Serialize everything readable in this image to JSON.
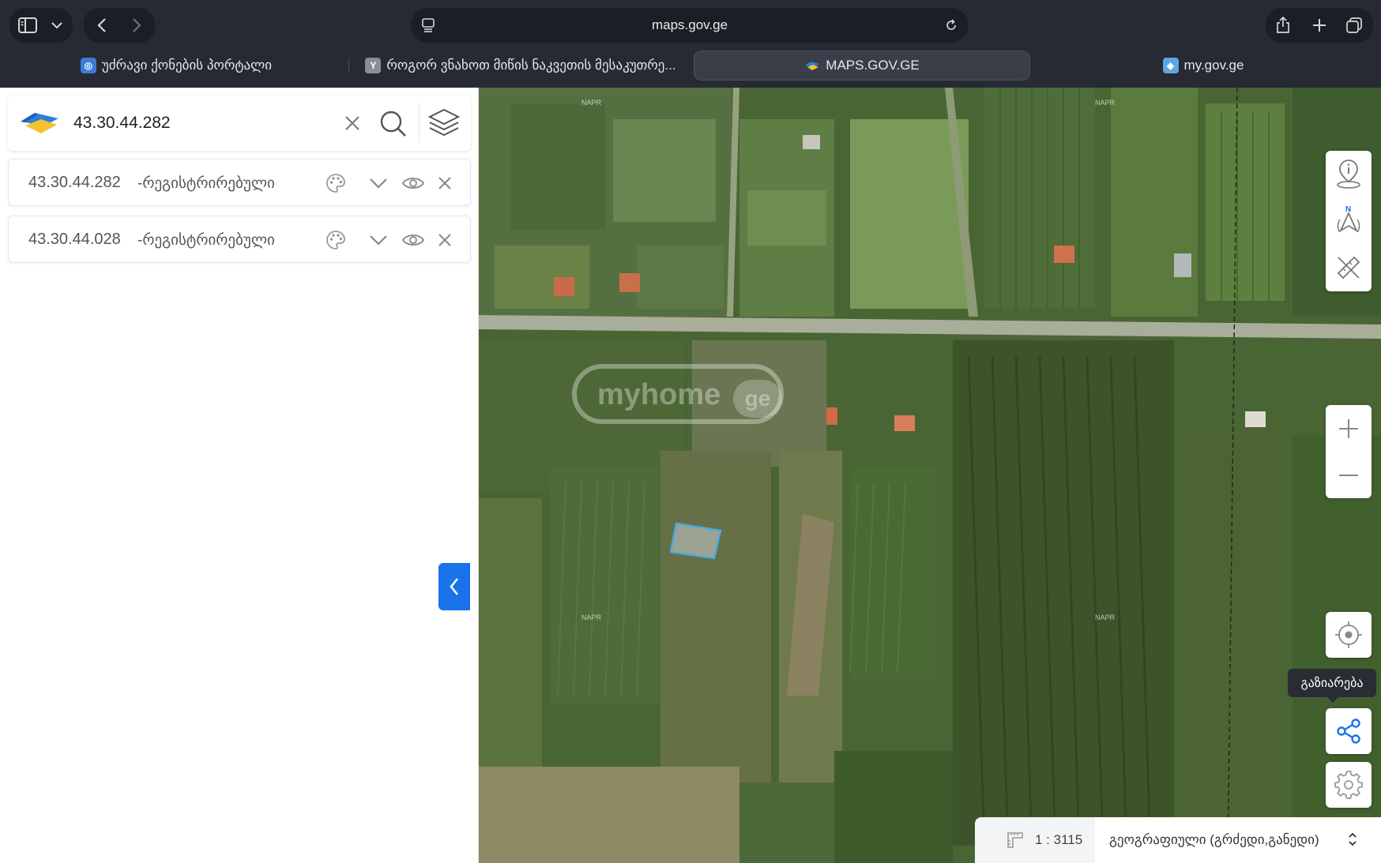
{
  "browser": {
    "url": "maps.gov.ge",
    "tabs": [
      {
        "label": "უძრავი ქონების პორტალი",
        "icon": "portal-favicon",
        "active": false
      },
      {
        "label": "როგორ ვნახოთ მიწის ნაკვეთის მესაკუთრე...",
        "icon": "y-favicon",
        "active": false
      },
      {
        "label": "MAPS.GOV.GE",
        "icon": "maps-favicon",
        "active": true
      },
      {
        "label": "my.gov.ge",
        "icon": "mygov-favicon",
        "active": false
      }
    ],
    "colors": {
      "chrome_bg": "#272a33",
      "active_tab_bg": "#3a3e49"
    }
  },
  "search": {
    "value": "43.30.44.282",
    "icons": [
      "clear-icon",
      "search-icon",
      "layers-icon"
    ]
  },
  "results": [
    {
      "code": "43.30.44.282",
      "status": "-რეგისტრირებული"
    },
    {
      "code": "43.30.44.028",
      "status": "-რეგისტრირებული"
    }
  ],
  "map": {
    "watermark": {
      "text": "myhome",
      "suffix": "ge"
    },
    "imagery_labels": [
      "NAPR",
      "NAPR",
      "NAPR",
      "NAPR"
    ],
    "tooltip": "გაზიარება",
    "scale": "1 : 3115",
    "projection": "გეოგრაფიული (გრძედი,განედი)",
    "accent": "#1a72e8"
  }
}
